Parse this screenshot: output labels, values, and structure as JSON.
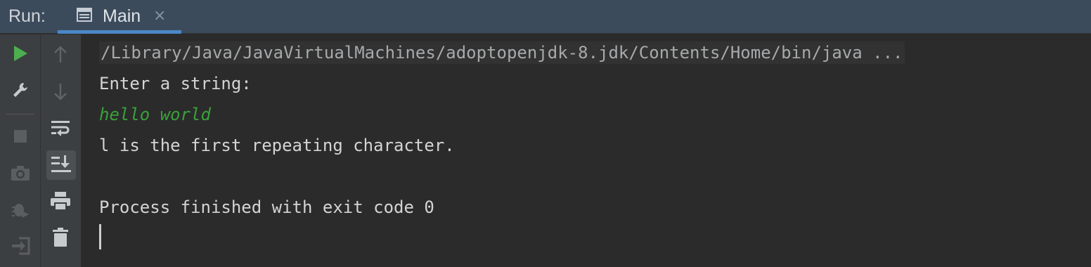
{
  "header": {
    "run_label": "Run:",
    "tab": {
      "label": "Main",
      "close_glyph": "×",
      "icon": "console-window-icon"
    }
  },
  "toolbar_left": [
    {
      "name": "rerun-icon",
      "state": "enabled",
      "color": "#4caf50"
    },
    {
      "name": "wrench-icon",
      "state": "enabled"
    },
    {
      "name": "stop-icon",
      "state": "disabled"
    },
    {
      "name": "camera-icon",
      "state": "disabled"
    },
    {
      "name": "debug-bug-icon",
      "state": "disabled"
    },
    {
      "name": "exit-login-icon",
      "state": "disabled"
    }
  ],
  "toolbar_right": [
    {
      "name": "arrow-up-icon",
      "state": "disabled"
    },
    {
      "name": "arrow-down-icon",
      "state": "disabled"
    },
    {
      "name": "soft-wrap-icon",
      "state": "enabled"
    },
    {
      "name": "scroll-to-end-icon",
      "state": "active"
    },
    {
      "name": "print-icon",
      "state": "enabled"
    },
    {
      "name": "trash-icon",
      "state": "enabled"
    }
  ],
  "console": {
    "command": "/Library/Java/JavaVirtualMachines/adoptopenjdk-8.jdk/Contents/Home/bin/java ...",
    "prompt": "Enter a string:",
    "user_input": "hello world",
    "result": "l is the first repeating character.",
    "exit_message": "Process finished with exit code 0"
  },
  "colors": {
    "header_bg": "#3c4b5c",
    "accent": "#4a88c7",
    "console_bg": "#2b2b2b",
    "input_text": "#3aa13a",
    "run_green": "#4caf50"
  }
}
